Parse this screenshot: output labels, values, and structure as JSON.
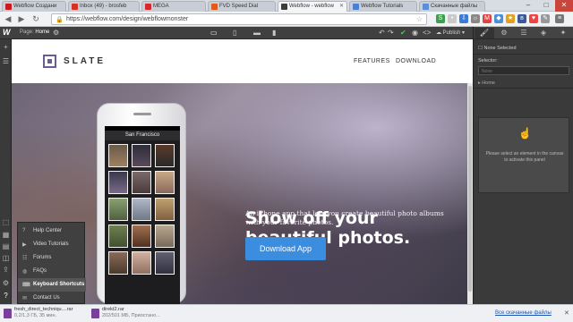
{
  "browser": {
    "tabs": [
      {
        "label": "Webflow Создани",
        "color": "#cc181e"
      },
      {
        "label": "Inbox (49) - brosfeb",
        "color": "#d93025"
      },
      {
        "label": "MEGA",
        "color": "#d9272e"
      },
      {
        "label": "FVD Speed Dial",
        "color": "#e05a1f"
      },
      {
        "label": "Webflow - webflow",
        "color": "#3d3d3d"
      },
      {
        "label": "Webflow Tutorials",
        "color": "#4a7fd4"
      },
      {
        "label": "Скачанные файлы",
        "color": "#5b8dd9"
      }
    ],
    "url": "https://webflow.com/design/webflowmonster",
    "window_controls": {
      "minimize": "–",
      "maximize": "□",
      "close": "✕"
    }
  },
  "webflow_top": {
    "logo": "W",
    "page_label": "Page:",
    "page_name": "Home",
    "publish_label": "Publish"
  },
  "site": {
    "brand": "SLATE",
    "nav": [
      "FEATURES",
      "DOWNLOAD"
    ],
    "headline": [
      "Show off your",
      "beautiful photos."
    ],
    "subtext": "An iPhone app that lets you create beautiful photo albums with your favorite photos.",
    "cta": "Download App",
    "phone_title": "San Francisco"
  },
  "help_menu": {
    "items": [
      {
        "label": "Help Center",
        "icon": "question-icon",
        "highlighted": false
      },
      {
        "label": "Video Tutorials",
        "icon": "video-icon",
        "highlighted": false
      },
      {
        "label": "Forums",
        "icon": "forum-icon",
        "highlighted": false
      },
      {
        "label": "FAQs",
        "icon": "faq-icon",
        "highlighted": false
      },
      {
        "label": "Keyboard Shortcuts",
        "icon": "keyboard-icon",
        "highlighted": true
      },
      {
        "label": "Contact Us",
        "icon": "mail-icon",
        "highlighted": false
      }
    ]
  },
  "right_panel": {
    "none_selected": "None Selected",
    "selector_label": "Selector:",
    "selector_placeholder": "None",
    "home_label": "Home",
    "empty_message": "Please select an element in the canvas to activate this panel"
  },
  "downloads": {
    "items": [
      {
        "name": "fresh_direct_techniqu....rar",
        "status": "0,2/1,3 ГБ, 35 мин."
      },
      {
        "name": "direkt2.rar",
        "status": "202/501 МБ, Приостано..."
      }
    ],
    "show_all": "Все скачанные файлы"
  }
}
